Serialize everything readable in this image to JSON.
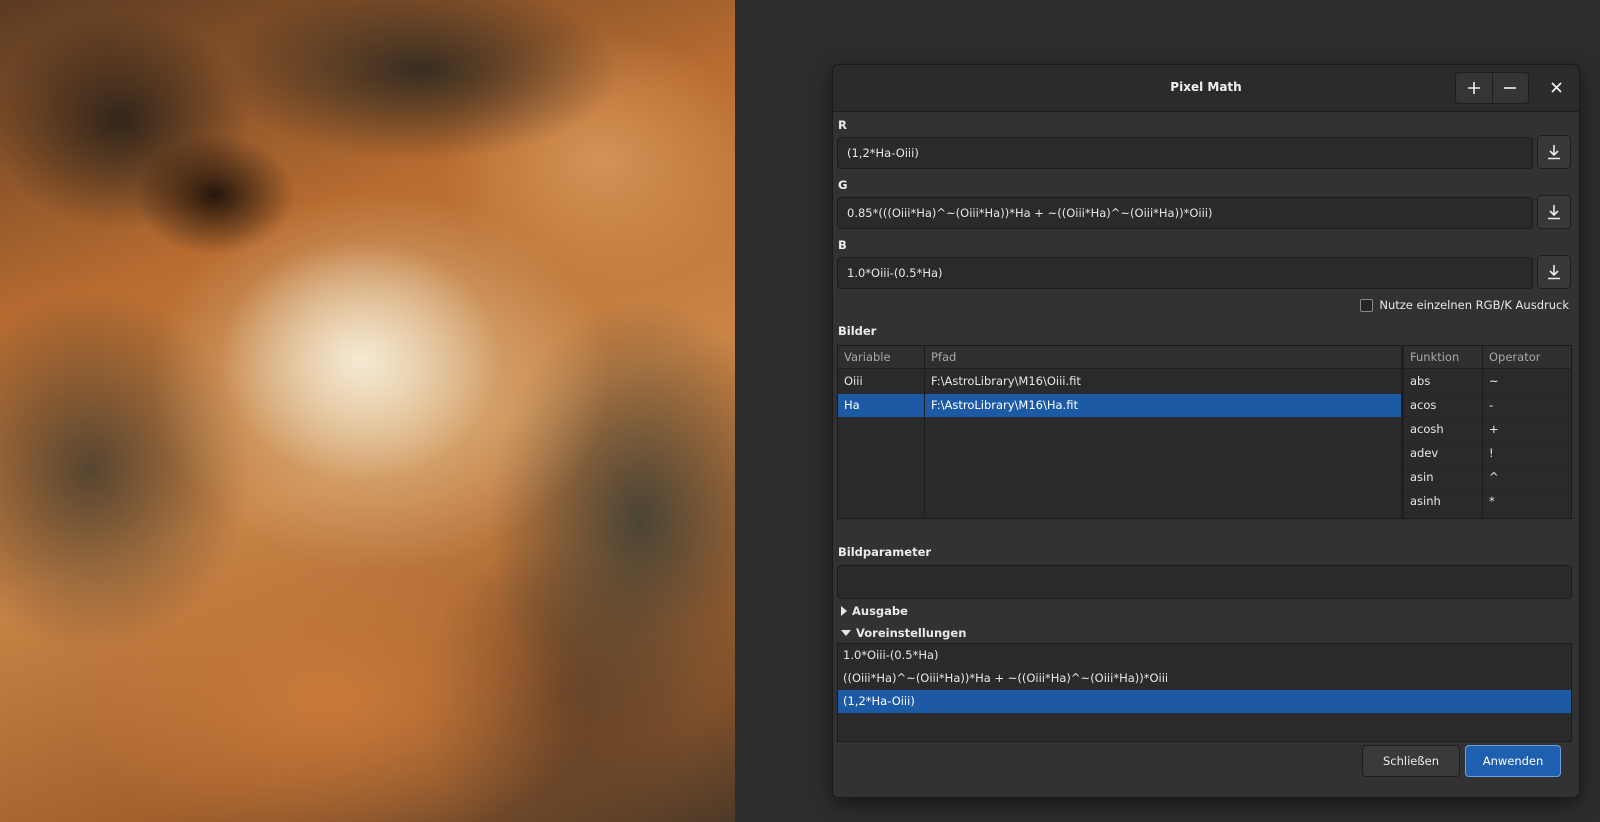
{
  "dialog": {
    "title": "Pixel Math",
    "add_icon": "plus-icon",
    "remove_icon": "minus-icon",
    "close_icon": "close-icon"
  },
  "expressions": {
    "r_label": "R",
    "r_value": "(1,2*Ha-Oiii)",
    "g_label": "G",
    "g_value": "0.85*(((Oiii*Ha)^~(Oiii*Ha))*Ha + ~((Oiii*Ha)^~(Oiii*Ha))*Oiii)",
    "b_label": "B",
    "b_value": "1.0*Oiii-(0.5*Ha)",
    "single_expr_label": "Nutze einzelnen RGB/K Ausdruck",
    "single_expr_checked": false,
    "download_icon": "download-icon"
  },
  "images": {
    "section_label": "Bilder",
    "columns": {
      "variable": "Variable",
      "path": "Pfad",
      "function": "Funktion",
      "operator": "Operator"
    },
    "rows": [
      {
        "variable": "Oiii",
        "path": "F:\\AstroLibrary\\M16\\Oiii.fit",
        "selected": false
      },
      {
        "variable": "Ha",
        "path": "F:\\AstroLibrary\\M16\\Ha.fit",
        "selected": true
      }
    ],
    "functions": [
      "abs",
      "acos",
      "acosh",
      "adev",
      "asin",
      "asinh"
    ],
    "operators": [
      "~",
      "-",
      "+",
      "!",
      "^",
      "*"
    ]
  },
  "params": {
    "section_label": "Bildparameter",
    "value": ""
  },
  "output": {
    "label": "Ausgabe",
    "expanded": false
  },
  "presets": {
    "label": "Voreinstellungen",
    "expanded": true,
    "items": [
      {
        "text": "1.0*Oiii-(0.5*Ha)",
        "selected": false
      },
      {
        "text": "((Oiii*Ha)^~(Oiii*Ha))*Ha + ~((Oiii*Ha)^~(Oiii*Ha))*Oiii",
        "selected": false
      },
      {
        "text": "(1,2*Ha-Oiii)",
        "selected": true
      }
    ]
  },
  "buttons": {
    "close_label": "Schließen",
    "apply_label": "Anwenden"
  },
  "colors": {
    "selection": "#1d5aa6",
    "accent": "#1f5fb0"
  }
}
